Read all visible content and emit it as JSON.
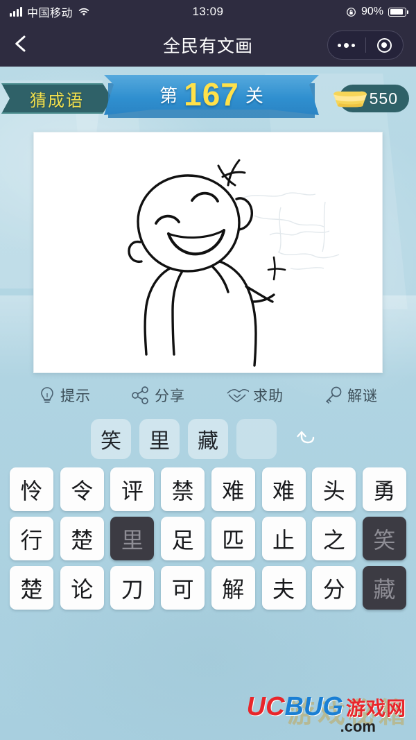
{
  "status_bar": {
    "carrier": "中国移动",
    "time": "13:09",
    "battery_percent": "90%",
    "signal_icon": "signal-bars-icon",
    "wifi_icon": "wifi-icon",
    "rotation_lock_icon": "rotation-lock-icon",
    "battery_icon": "battery-icon"
  },
  "nav_bar": {
    "title": "全民有文画",
    "back_icon": "chevron-left-icon",
    "more_icon": "more-dots-icon",
    "target_icon": "target-circle-icon"
  },
  "game_header": {
    "category": "猜成语",
    "level_prefix": "第",
    "level_number": "167",
    "level_suffix": "关",
    "coins": "550",
    "coin_icon": "gold-ingot-icon"
  },
  "actions": [
    {
      "label": "提示",
      "icon": "lightbulb-icon"
    },
    {
      "label": "分享",
      "icon": "share-nodes-icon"
    },
    {
      "label": "求助",
      "icon": "handshake-icon"
    },
    {
      "label": "解谜",
      "icon": "key-icon"
    }
  ],
  "answer_slots": [
    {
      "char": "笑",
      "filled": true
    },
    {
      "char": "里",
      "filled": true
    },
    {
      "char": "藏",
      "filled": true
    },
    {
      "char": "",
      "filled": false
    }
  ],
  "undo": {
    "icon": "undo-arrow-icon"
  },
  "char_grid": {
    "rows": [
      [
        {
          "char": "怜",
          "used": false
        },
        {
          "char": "令",
          "used": false
        },
        {
          "char": "评",
          "used": false
        },
        {
          "char": "禁",
          "used": false
        },
        {
          "char": "难",
          "used": false
        },
        {
          "char": "难",
          "used": false
        },
        {
          "char": "头",
          "used": false
        },
        {
          "char": "勇",
          "used": false
        }
      ],
      [
        {
          "char": "行",
          "used": false
        },
        {
          "char": "楚",
          "used": false
        },
        {
          "char": "里",
          "used": true
        },
        {
          "char": "足",
          "used": false
        },
        {
          "char": "匹",
          "used": false
        },
        {
          "char": "止",
          "used": false
        },
        {
          "char": "之",
          "used": false
        },
        {
          "char": "笑",
          "used": true
        }
      ],
      [
        {
          "char": "楚",
          "used": false
        },
        {
          "char": "论",
          "used": false
        },
        {
          "char": "刀",
          "used": false
        },
        {
          "char": "可",
          "used": false
        },
        {
          "char": "解",
          "used": false
        },
        {
          "char": "夫",
          "used": false
        },
        {
          "char": "分",
          "used": false
        },
        {
          "char": "藏",
          "used": true
        }
      ]
    ]
  },
  "watermark": {
    "uc": "UC",
    "bug": "BUG",
    "cn": "游戏网",
    "com": ".com",
    "ghost": "游戏秘籍"
  },
  "colors": {
    "nav_bg": "#2e2c40",
    "page_bg": "#b4d7e4",
    "tag_bg": "#2f6168",
    "tag_text": "#f2e14e",
    "ribbon_blue": "#2f8fcf",
    "level_yellow": "#ffe14a",
    "tile_bg": "#fdfdfd",
    "tile_used_bg": "#3c3b43"
  }
}
